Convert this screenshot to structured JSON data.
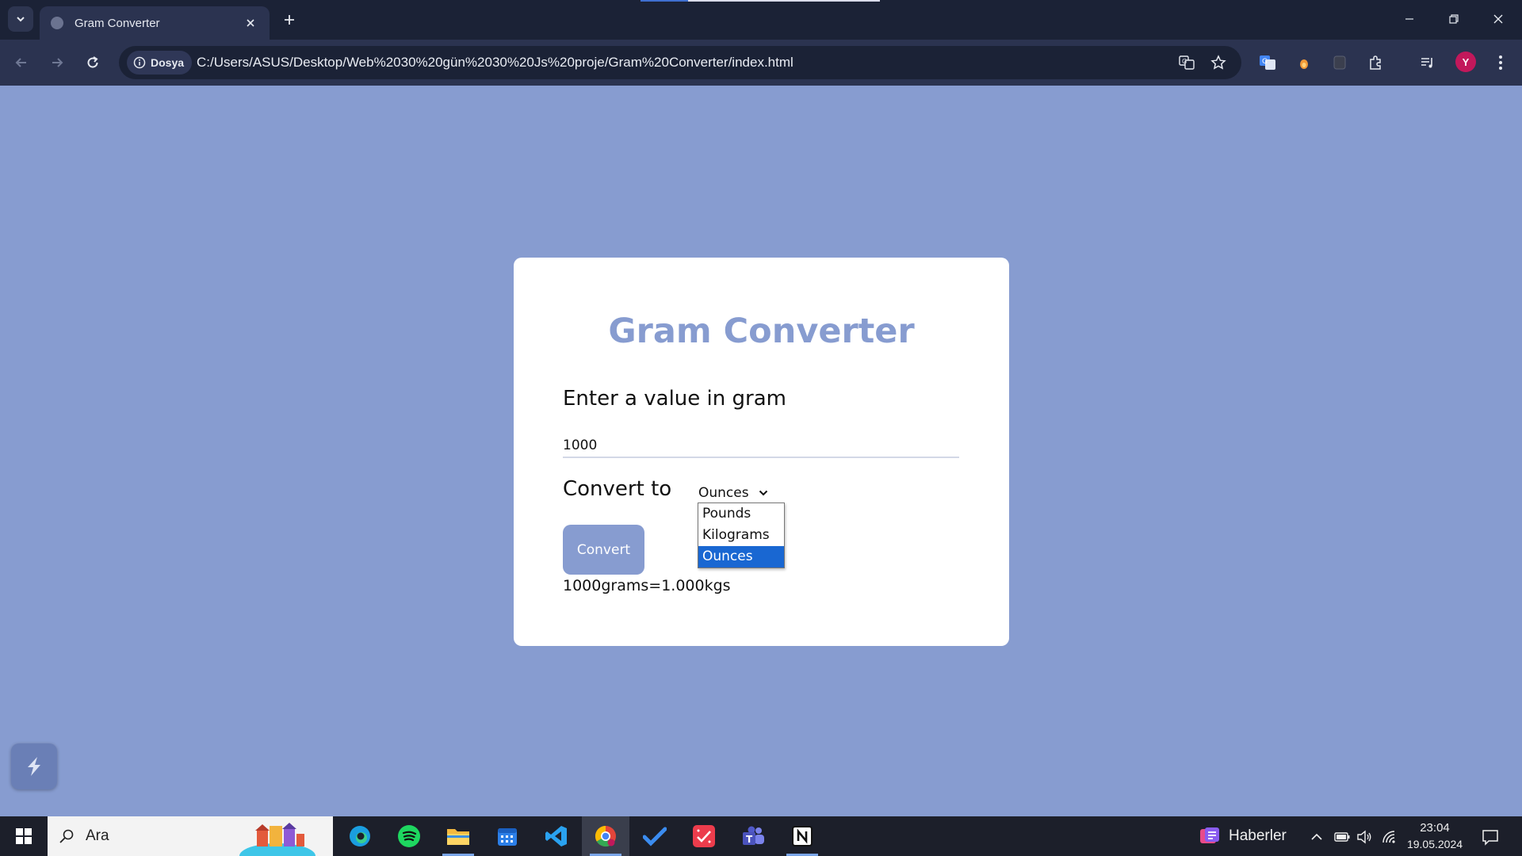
{
  "browser": {
    "tab_title": "Gram Converter",
    "site_chip_label": "Dosya",
    "url": "C:/Users/ASUS/Desktop/Web%2030%20gün%2030%20Js%20proje/Gram%20Converter/index.html",
    "profile_initial": "Y",
    "profile_color": "#c2185b"
  },
  "page": {
    "background_color": "#879cd0",
    "accent_color": "#879cd0",
    "title": "Gram Converter",
    "value_label": "Enter a value in gram",
    "gram_value": "1000",
    "convert_label": "Convert to",
    "selected_unit": "Ounces",
    "unit_options": [
      "Pounds",
      "Kilograms",
      "Ounces"
    ],
    "highlighted_option": "Ounces",
    "convert_button": "Convert",
    "result": "1000grams=1.000kgs"
  },
  "taskbar": {
    "search_placeholder": "Ara",
    "news_label": "Haberler",
    "time": "23:04",
    "date": "19.05.2024",
    "apps": [
      "edge-icon",
      "spotify-icon",
      "file-explorer-icon",
      "calendar-icon",
      "vscode-icon",
      "chrome-icon",
      "todo-icon",
      "app-icon",
      "teams-icon",
      "notion-icon"
    ]
  }
}
